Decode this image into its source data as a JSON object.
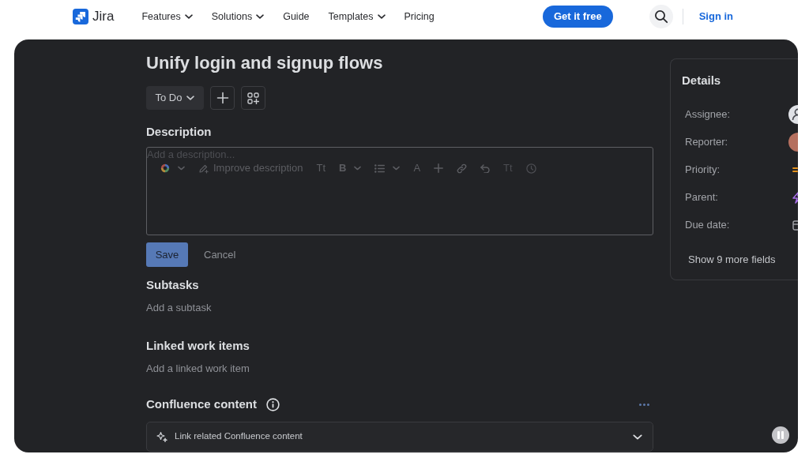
{
  "header": {
    "logo": "Jira",
    "nav": [
      {
        "label": "Features",
        "dropdown": true
      },
      {
        "label": "Solutions",
        "dropdown": true
      },
      {
        "label": "Guide",
        "dropdown": false
      },
      {
        "label": "Templates",
        "dropdown": true
      },
      {
        "label": "Pricing",
        "dropdown": false
      }
    ],
    "cta": "Get it free",
    "sign_in": "Sign in"
  },
  "video": {
    "playing": true,
    "work_item": {
      "title": "Unify login and signup flows",
      "status": "To Do",
      "description": {
        "heading": "Description",
        "placeholder": "Add a description...",
        "toolbar": [
          {
            "kind": "ai",
            "menu": true,
            "disabled": false
          },
          {
            "kind": "improve",
            "label": "Improve description",
            "menu": false,
            "disabled": false
          },
          {
            "kind": "style",
            "label": "Tt",
            "menu": false,
            "disabled": false
          },
          {
            "kind": "bold",
            "label": "B",
            "menu": true,
            "disabled": false
          },
          {
            "kind": "list",
            "menu": true,
            "disabled": false
          },
          {
            "kind": "color",
            "label": "A",
            "menu": false,
            "disabled": false
          },
          {
            "kind": "insert",
            "menu": false,
            "disabled": false
          },
          {
            "kind": "link",
            "menu": false,
            "disabled": false
          },
          {
            "kind": "undo",
            "menu": false,
            "disabled": false
          },
          {
            "kind": "style",
            "label": "Tt",
            "menu": false,
            "disabled": true
          },
          {
            "kind": "history",
            "menu": false,
            "disabled": true
          }
        ],
        "buttons": [
          {
            "label": "Save",
            "kind": "primary"
          },
          {
            "label": "Cancel",
            "kind": "subtle"
          }
        ]
      },
      "sections": [
        {
          "heading": "Subtasks",
          "action": "Add a subtask"
        },
        {
          "heading": "Linked work items",
          "action": "Add a linked work item"
        }
      ],
      "confluence": {
        "heading": "Confluence content",
        "link": "Link related Confluence content"
      }
    },
    "details": {
      "heading": "Details",
      "fields": [
        {
          "label": "Assignee:",
          "kind": "unassigned"
        },
        {
          "label": "Reporter:",
          "kind": "user"
        },
        {
          "label": "Priority:",
          "kind": "priority"
        },
        {
          "label": "Parent:",
          "kind": "parent"
        },
        {
          "label": "Due date:",
          "kind": "date"
        }
      ],
      "more": "Show 9 more fields"
    }
  }
}
